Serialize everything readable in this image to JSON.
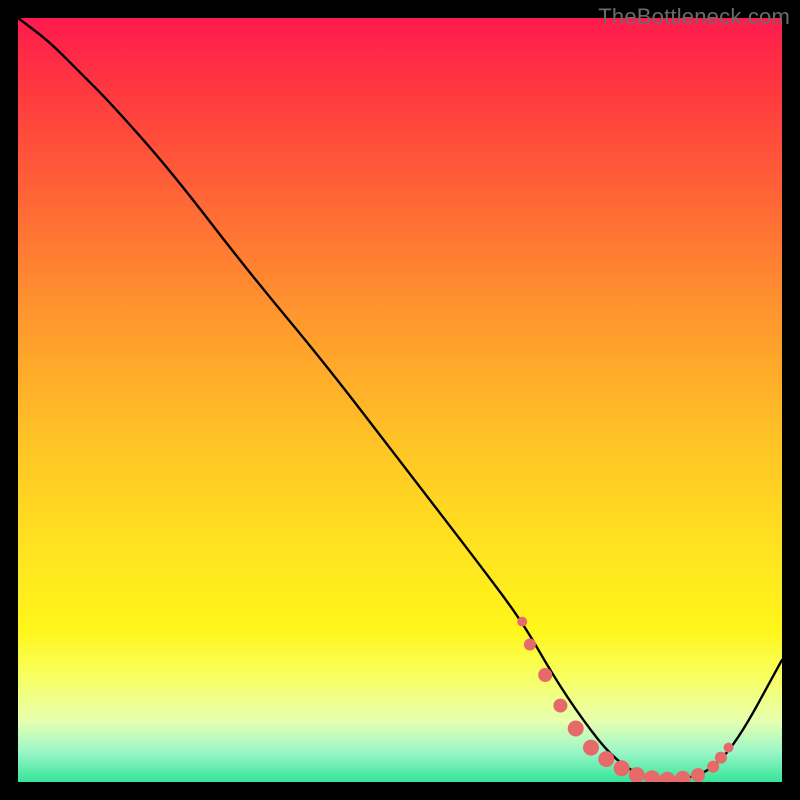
{
  "watermark": "TheBottleneck.com",
  "chart_data": {
    "type": "line",
    "title": "",
    "xlabel": "",
    "ylabel": "",
    "xlim": [
      0,
      100
    ],
    "ylim": [
      0,
      100
    ],
    "series": [
      {
        "name": "curve",
        "x": [
          0,
          4,
          8,
          12,
          20,
          30,
          40,
          50,
          60,
          66,
          70,
          74,
          78,
          82,
          86,
          90,
          94,
          100
        ],
        "y": [
          100,
          97,
          93,
          89,
          80,
          67,
          55,
          42,
          29,
          21,
          14,
          8,
          3,
          0.5,
          0.3,
          1,
          5,
          16
        ]
      }
    ],
    "dots": {
      "name": "highlight",
      "color": "#e76a6a",
      "x": [
        66,
        67,
        69,
        71,
        73,
        75,
        77,
        79,
        81,
        83,
        85,
        87,
        89,
        91,
        92,
        93
      ],
      "y": [
        21,
        18,
        14,
        10,
        7,
        4.5,
        3,
        1.8,
        0.9,
        0.5,
        0.3,
        0.4,
        0.9,
        2,
        3.2,
        4.5
      ],
      "sizes": [
        5,
        6,
        7,
        7,
        8,
        8,
        8,
        8,
        8,
        8,
        8,
        8,
        7,
        6,
        6,
        5
      ]
    }
  }
}
